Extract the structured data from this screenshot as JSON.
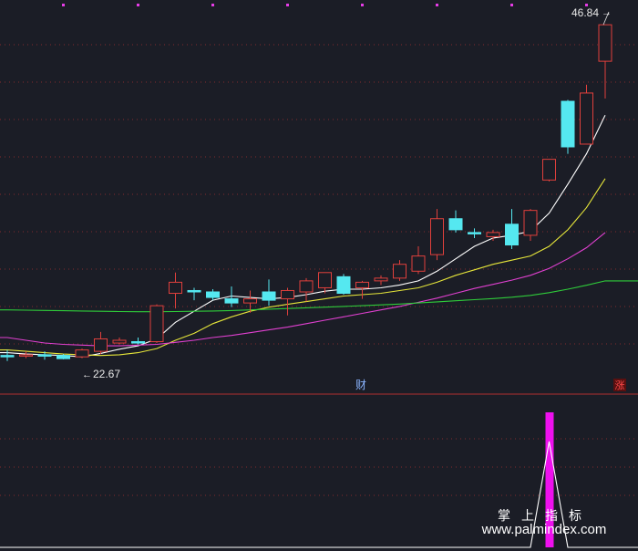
{
  "chart_data": {
    "type": "candlestick",
    "panels": [
      "price",
      "indicator"
    ],
    "colors": {
      "background": "#1b1d26",
      "up": "#e0403c",
      "down": "#55e8f0",
      "grid": "#b03030",
      "ma_short": "#ffffff",
      "ma_mid": "#e6e63a",
      "ma_long": "#e040d0",
      "ma_longest": "#2fcc3a",
      "marker": "#e63ce6",
      "indicator_bar": "#ee10ee",
      "indicator_line": "#ffffff",
      "label": "#e8e8e8",
      "finance_label": "#8ab4ff",
      "limit_label": "#ff4a4a"
    },
    "price_range": [
      20.5,
      48.5
    ],
    "candles": [
      {
        "o": 22.9,
        "h": 23.3,
        "l": 22.5,
        "c": 22.8
      },
      {
        "o": 22.9,
        "h": 23.2,
        "l": 22.7,
        "c": 22.95
      },
      {
        "o": 22.95,
        "h": 23.2,
        "l": 22.6,
        "c": 22.85
      },
      {
        "o": 22.9,
        "h": 23.0,
        "l": 22.62,
        "c": 22.67
      },
      {
        "o": 22.8,
        "h": 23.4,
        "l": 22.7,
        "c": 23.3
      },
      {
        "o": 23.2,
        "h": 24.6,
        "l": 23.0,
        "c": 24.1
      },
      {
        "o": 23.8,
        "h": 24.2,
        "l": 23.7,
        "c": 24.0
      },
      {
        "o": 23.9,
        "h": 24.2,
        "l": 23.7,
        "c": 23.8
      },
      {
        "o": 23.9,
        "h": 26.6,
        "l": 23.8,
        "c": 26.5
      },
      {
        "o": 27.4,
        "h": 28.9,
        "l": 26.3,
        "c": 28.2
      },
      {
        "o": 27.6,
        "h": 27.8,
        "l": 26.9,
        "c": 27.5
      },
      {
        "o": 27.5,
        "h": 27.7,
        "l": 26.9,
        "c": 27.1
      },
      {
        "o": 27.0,
        "h": 27.9,
        "l": 26.4,
        "c": 26.7
      },
      {
        "o": 26.7,
        "h": 27.6,
        "l": 26.0,
        "c": 27.0
      },
      {
        "o": 27.5,
        "h": 28.4,
        "l": 26.5,
        "c": 26.9
      },
      {
        "o": 27.0,
        "h": 27.8,
        "l": 25.8,
        "c": 27.6
      },
      {
        "o": 27.5,
        "h": 28.5,
        "l": 26.8,
        "c": 28.3
      },
      {
        "o": 27.8,
        "h": 28.8,
        "l": 27.4,
        "c": 28.9
      },
      {
        "o": 28.6,
        "h": 28.8,
        "l": 27.3,
        "c": 27.4
      },
      {
        "o": 27.8,
        "h": 28.3,
        "l": 27.0,
        "c": 28.2
      },
      {
        "o": 28.3,
        "h": 28.7,
        "l": 28.0,
        "c": 28.5
      },
      {
        "o": 28.5,
        "h": 29.8,
        "l": 28.3,
        "c": 29.5
      },
      {
        "o": 29.0,
        "h": 30.8,
        "l": 28.8,
        "c": 30.1
      },
      {
        "o": 30.2,
        "h": 33.5,
        "l": 29.8,
        "c": 32.8
      },
      {
        "o": 32.8,
        "h": 33.4,
        "l": 31.8,
        "c": 32.0
      },
      {
        "o": 31.8,
        "h": 32.1,
        "l": 31.4,
        "c": 31.7
      },
      {
        "o": 31.5,
        "h": 32.0,
        "l": 31.2,
        "c": 31.8
      },
      {
        "o": 32.4,
        "h": 33.5,
        "l": 30.6,
        "c": 30.9
      },
      {
        "o": 31.6,
        "h": 33.5,
        "l": 31.2,
        "c": 33.4
      },
      {
        "o": 35.6,
        "h": 37.1,
        "l": 35.5,
        "c": 37.1
      },
      {
        "o": 41.3,
        "h": 41.4,
        "l": 37.5,
        "c": 38.0
      },
      {
        "o": 38.2,
        "h": 42.5,
        "l": 38.2,
        "c": 41.9
      },
      {
        "o": 44.2,
        "h": 46.84,
        "l": 41.5,
        "c": 46.84
      }
    ],
    "moving_averages": [
      {
        "name": "ma_short",
        "values": [
          23.1,
          23.0,
          22.95,
          22.9,
          22.8,
          23.05,
          23.35,
          23.6,
          24.1,
          25.3,
          26.1,
          26.9,
          27.2,
          27.1,
          27.0,
          27.1,
          27.3,
          27.55,
          27.7,
          27.7,
          27.8,
          28.0,
          28.3,
          29.0,
          29.9,
          30.8,
          31.4,
          31.6,
          31.9,
          33.2,
          35.3,
          37.5,
          40.3
        ]
      },
      {
        "name": "ma_mid",
        "values": [
          23.3,
          23.2,
          23.1,
          23.0,
          22.95,
          22.9,
          22.95,
          23.1,
          23.4,
          24.0,
          24.5,
          25.2,
          25.7,
          26.1,
          26.4,
          26.6,
          26.8,
          27.0,
          27.2,
          27.3,
          27.4,
          27.6,
          27.8,
          28.2,
          28.7,
          29.1,
          29.5,
          29.8,
          30.1,
          30.8,
          32.0,
          33.6,
          35.7
        ]
      },
      {
        "name": "ma_long",
        "values": [
          24.2,
          24.0,
          23.8,
          23.7,
          23.65,
          23.6,
          23.6,
          23.65,
          23.7,
          23.85,
          24.0,
          24.2,
          24.35,
          24.55,
          24.75,
          24.95,
          25.2,
          25.45,
          25.7,
          25.95,
          26.2,
          26.45,
          26.75,
          27.05,
          27.4,
          27.75,
          28.05,
          28.35,
          28.7,
          29.2,
          29.9,
          30.7,
          31.8
        ]
      },
      {
        "name": "ma_longest",
        "values": [
          26.2,
          26.18,
          26.16,
          26.14,
          26.12,
          26.1,
          26.08,
          26.07,
          26.07,
          26.08,
          26.1,
          26.12,
          26.15,
          26.2,
          26.25,
          26.3,
          26.35,
          26.4,
          26.45,
          26.5,
          26.56,
          26.62,
          26.7,
          26.78,
          26.86,
          26.94,
          27.02,
          27.12,
          27.25,
          27.45,
          27.7,
          27.98,
          28.3
        ]
      }
    ],
    "high_label": "46.84",
    "low_label": "22.67",
    "high_arrow": "→",
    "low_arrow": "←",
    "finance_label": "财",
    "limit_label": "涨",
    "indicator_peak_index": 29,
    "indicator_levels": [
      0,
      0,
      0,
      0,
      0,
      0,
      0,
      0,
      0,
      0,
      0,
      0,
      0,
      0,
      0,
      0,
      0,
      0,
      0,
      0,
      0,
      0,
      0,
      0,
      0,
      0,
      0,
      0,
      0,
      1,
      0,
      0,
      0
    ]
  },
  "watermark": {
    "line1": "掌上指标",
    "line2": "www.palmindex.com"
  }
}
